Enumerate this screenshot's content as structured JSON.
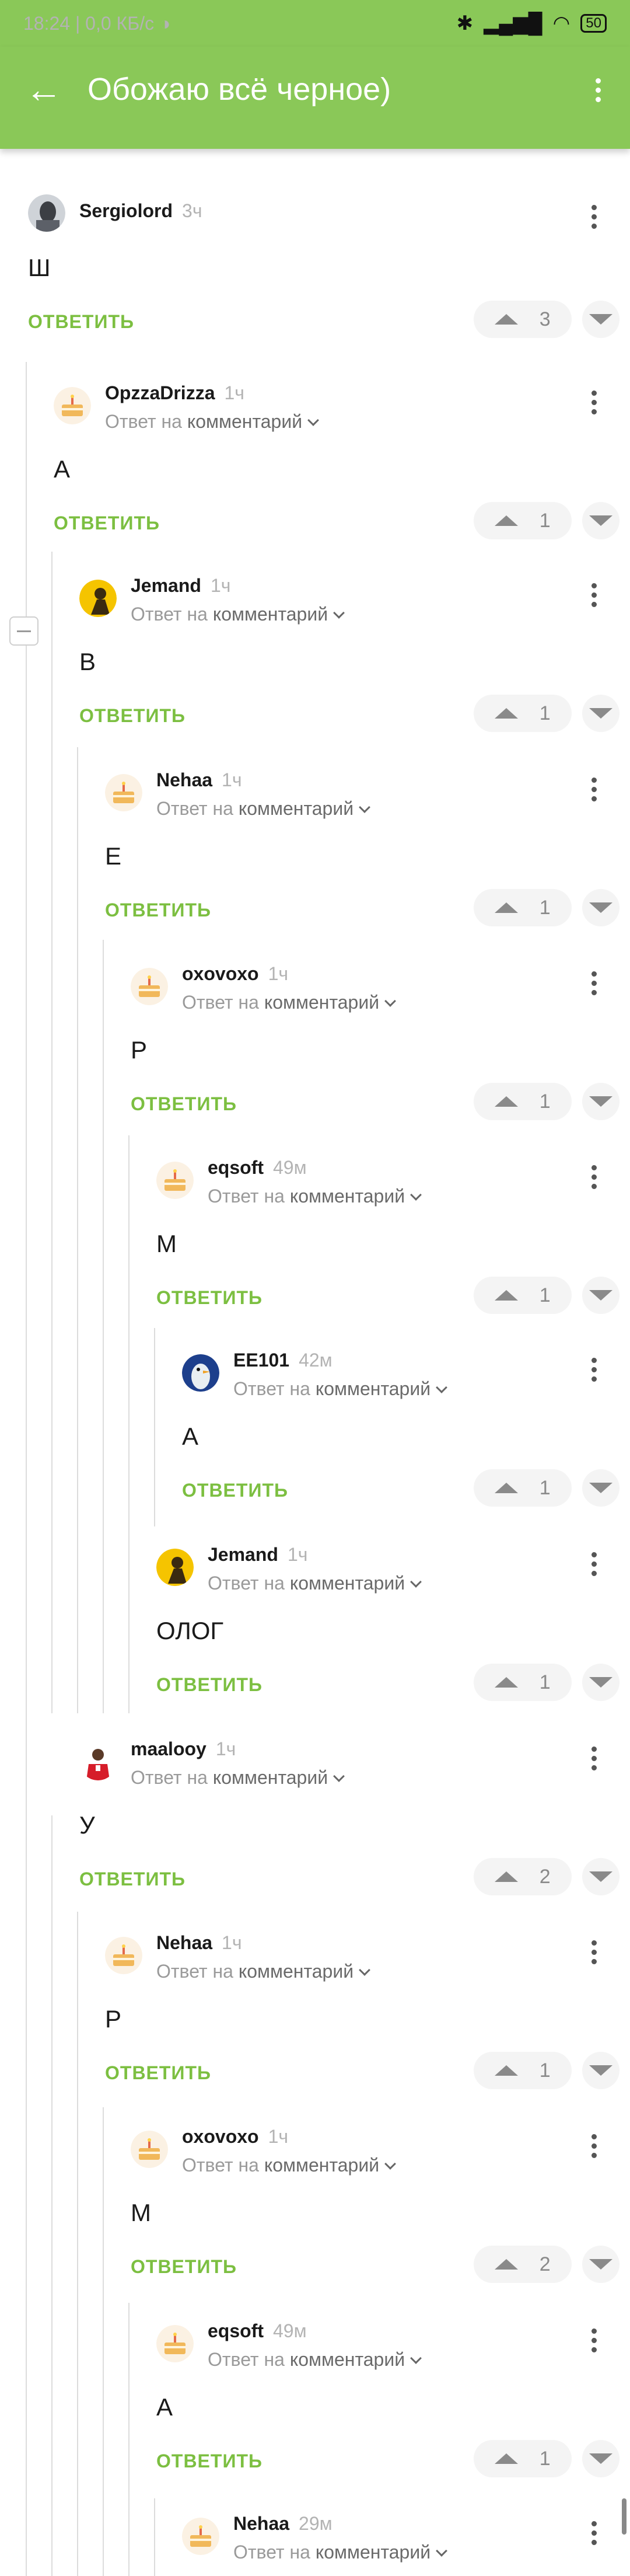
{
  "status_bar": {
    "time": "18:24",
    "net_speed": "0,0 КБ/с",
    "battery": "50"
  },
  "appbar": {
    "title": "Обожаю всё черное)"
  },
  "labels": {
    "reply_to_prefix": "Ответ на",
    "reply_to_target": "комментарий",
    "reply_action": "ОТВЕТИТЬ"
  },
  "colors": {
    "brand_green": "#8ac858",
    "reply_green": "#7cbf41",
    "pill_bg": "#f4f4f4"
  },
  "comments": [
    {
      "author": "Sergiolord",
      "time": "3ч",
      "text": "Ш",
      "score": "3",
      "avatar": "bw-portrait-avatar"
    },
    {
      "author": "OpzzaDrizza",
      "time": "1ч",
      "text": "А",
      "score": "1",
      "avatar": "default-cake-avatar"
    },
    {
      "author": "Jemand",
      "time": "1ч",
      "text": "В",
      "score": "1",
      "avatar": "yellow-figure-avatar"
    },
    {
      "author": "Nehaa",
      "time": "1ч",
      "text": "Е",
      "score": "1",
      "avatar": "default-cake-avatar"
    },
    {
      "author": "oxovoxo",
      "time": "1ч",
      "text": "Р",
      "score": "1",
      "avatar": "default-cake-avatar"
    },
    {
      "author": "eqsoft",
      "time": "49м",
      "text": "М",
      "score": "1",
      "avatar": "default-cake-avatar"
    },
    {
      "author": "EE101",
      "time": "42м",
      "text": "А",
      "score": "1",
      "avatar": "bird-avatar"
    },
    {
      "author": "Jemand",
      "time": "1ч",
      "text": "ОЛОГ",
      "score": "1",
      "avatar": "yellow-figure-avatar"
    },
    {
      "author": "maalooy",
      "time": "1ч",
      "text": "У",
      "score": "2",
      "avatar": "red-jersey-avatar"
    },
    {
      "author": "Nehaa",
      "time": "1ч",
      "text": "Р",
      "score": "1",
      "avatar": "default-cake-avatar"
    },
    {
      "author": "oxovoxo",
      "time": "1ч",
      "text": "М",
      "score": "2",
      "avatar": "default-cake-avatar"
    },
    {
      "author": "eqsoft",
      "time": "49м",
      "text": "А",
      "score": "1",
      "avatar": "default-cake-avatar"
    },
    {
      "author": "Nehaa",
      "time": "29м",
      "text": "",
      "score": "",
      "avatar": "default-cake-avatar"
    }
  ]
}
